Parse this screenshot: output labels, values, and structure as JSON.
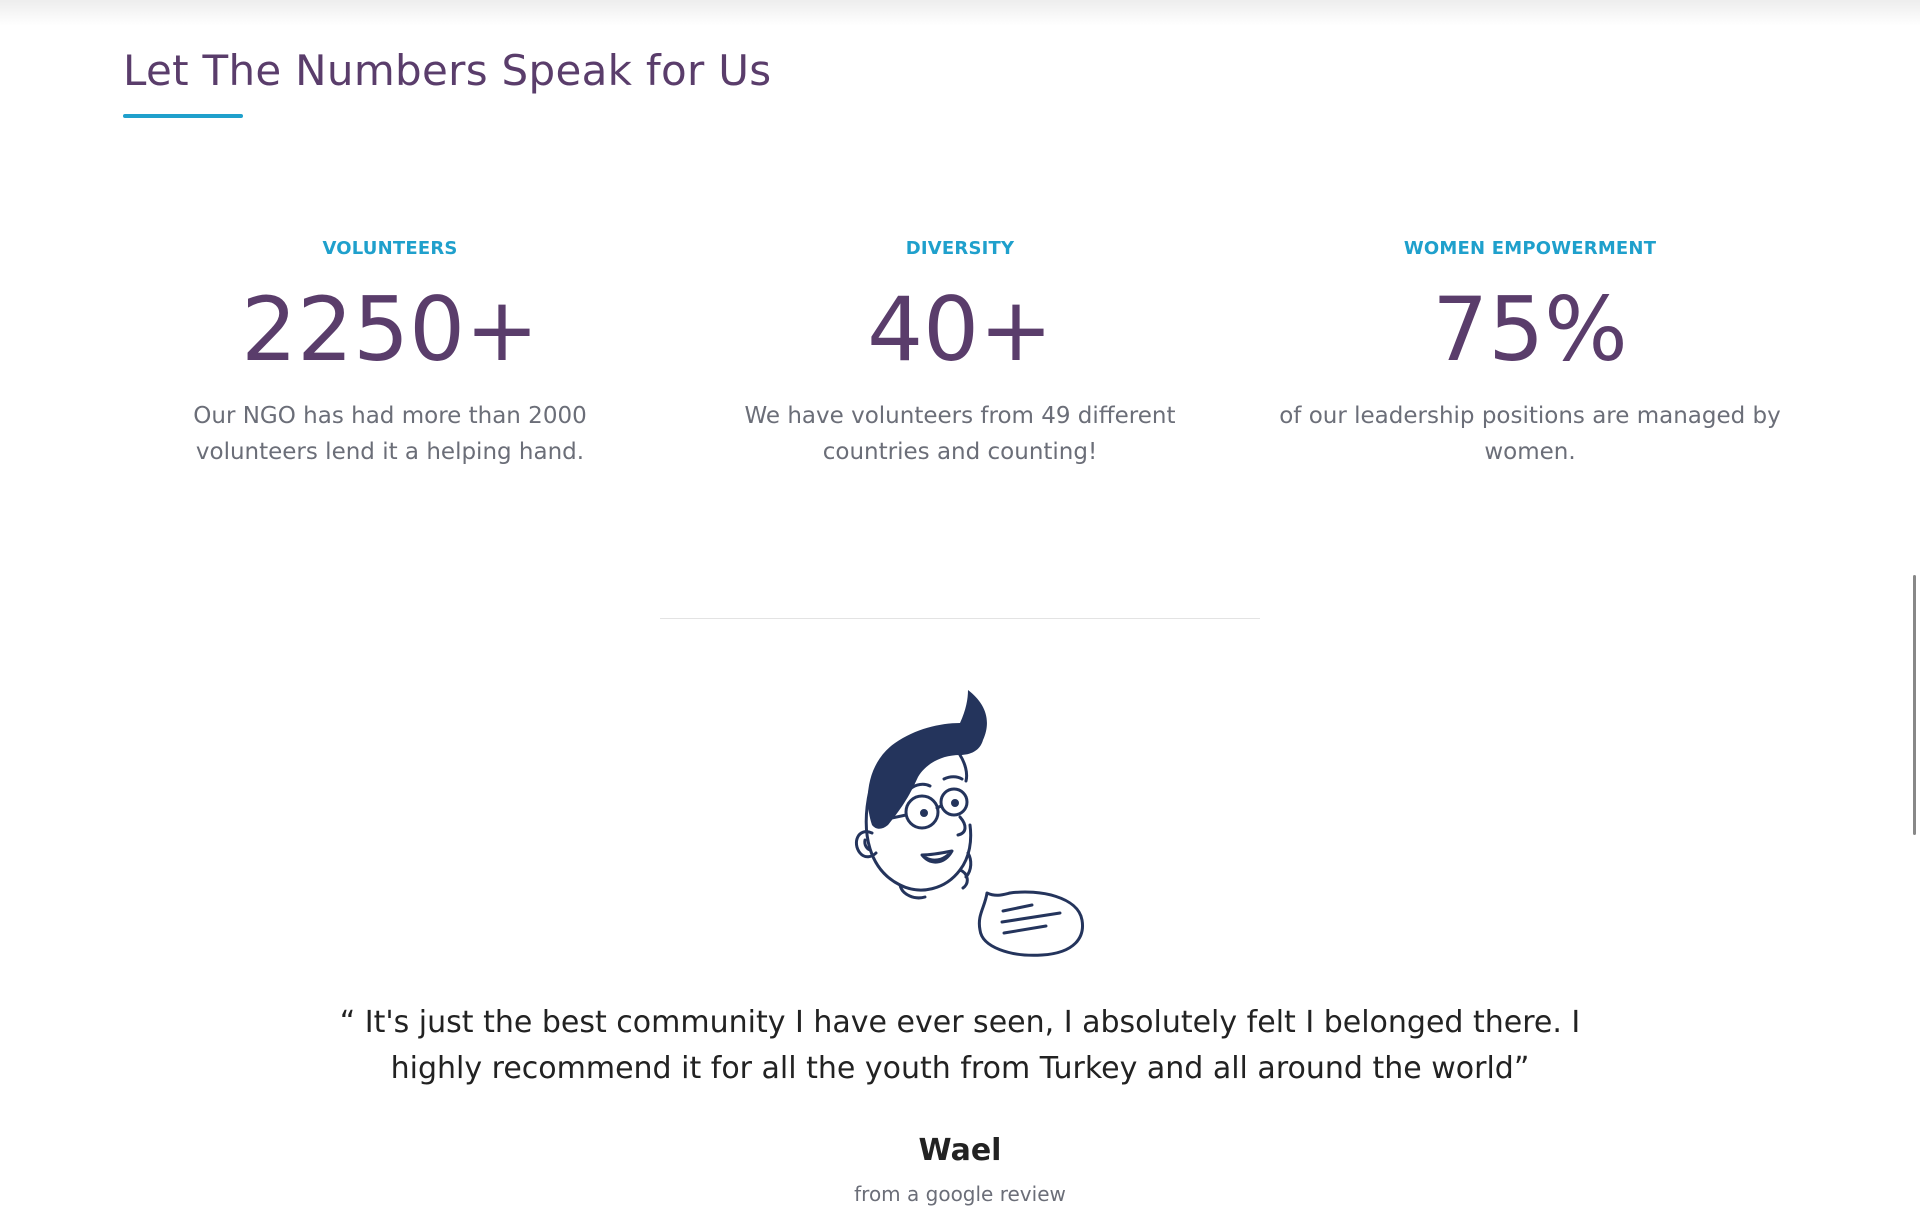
{
  "section": {
    "title": "Let The Numbers Speak for Us"
  },
  "stats": [
    {
      "label": "VOLUNTEERS",
      "value": "2250+",
      "description": "Our NGO has had more than 2000 volunteers lend it a helping hand."
    },
    {
      "label": "DIVERSITY",
      "value": "40+",
      "description": "We have volunteers from 49 different countries and counting!"
    },
    {
      "label": "WOMEN EMPOWERMENT",
      "value": "75%",
      "description": "of our leadership positions are managed by women."
    }
  ],
  "testimonial": {
    "avatar_icon": "man-with-glasses-speech-bubble-illustration",
    "quote": "“ It's just the best community I have ever seen, I absolutely felt I belonged there. I highly recommend it for all the youth from Turkey and all around the world”",
    "author": "Wael",
    "source": "from a google review"
  },
  "colors": {
    "title": "#5a3d6b",
    "accent": "#1fa0cc",
    "body_text": "#6b6e78",
    "illustration": "#24345c"
  }
}
